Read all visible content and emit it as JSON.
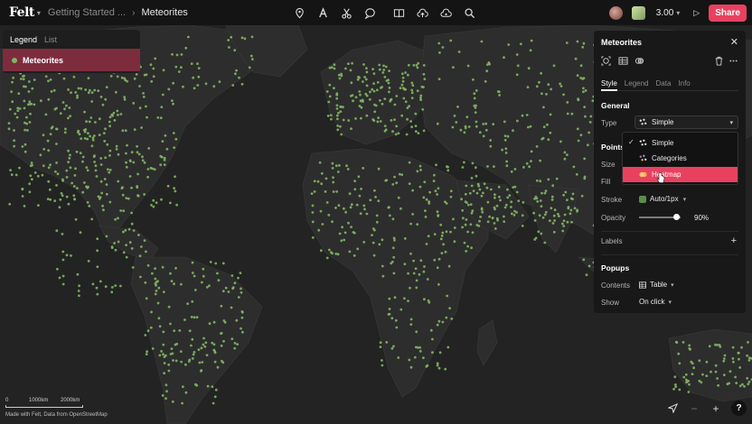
{
  "app": {
    "logo": "Felt",
    "breadcrumb": [
      "Getting Started ...",
      "Meteorites"
    ],
    "zoom": "3.00",
    "share_label": "Share",
    "colors": {
      "accent": "#e8415f",
      "points": "#82b563",
      "map_land": "#2b2b2b",
      "map_water": "#232323"
    }
  },
  "toolbar": {
    "icons": [
      "pin-icon",
      "text-icon",
      "scissors-icon",
      "comment-icon",
      "book-icon",
      "upload-icon",
      "cloud-icon",
      "search-icon"
    ]
  },
  "left_panel": {
    "tabs": [
      "Legend",
      "List"
    ],
    "active_tab": "Legend",
    "layer_name": "Meteorites"
  },
  "right_panel": {
    "title": "Meteorites",
    "tabs": [
      "Style",
      "Legend",
      "Data",
      "Info"
    ],
    "active_tab": "Style",
    "general": {
      "heading": "General",
      "type_label": "Type",
      "type_value": "Simple"
    },
    "points": {
      "heading": "Points",
      "size_label": "Size",
      "fill_label": "Fill",
      "stroke_label": "Stroke",
      "stroke_value": "Auto/1px",
      "opacity_label": "Opacity",
      "opacity_value": "90%",
      "opacity_fraction": 0.9
    },
    "labels": {
      "heading": "Labels"
    },
    "popups": {
      "heading": "Popups",
      "contents_label": "Contents",
      "contents_value": "Table",
      "show_label": "Show",
      "show_value": "On click"
    }
  },
  "type_dropdown": {
    "options": [
      "Simple",
      "Categories",
      "Heatmap"
    ],
    "selected": "Simple",
    "hovered": "Heatmap"
  },
  "map_footer": {
    "scale_labels": [
      "0",
      "1000km",
      "2000km"
    ],
    "attribution": "Made with Felt, Data from OpenStreetMap"
  }
}
